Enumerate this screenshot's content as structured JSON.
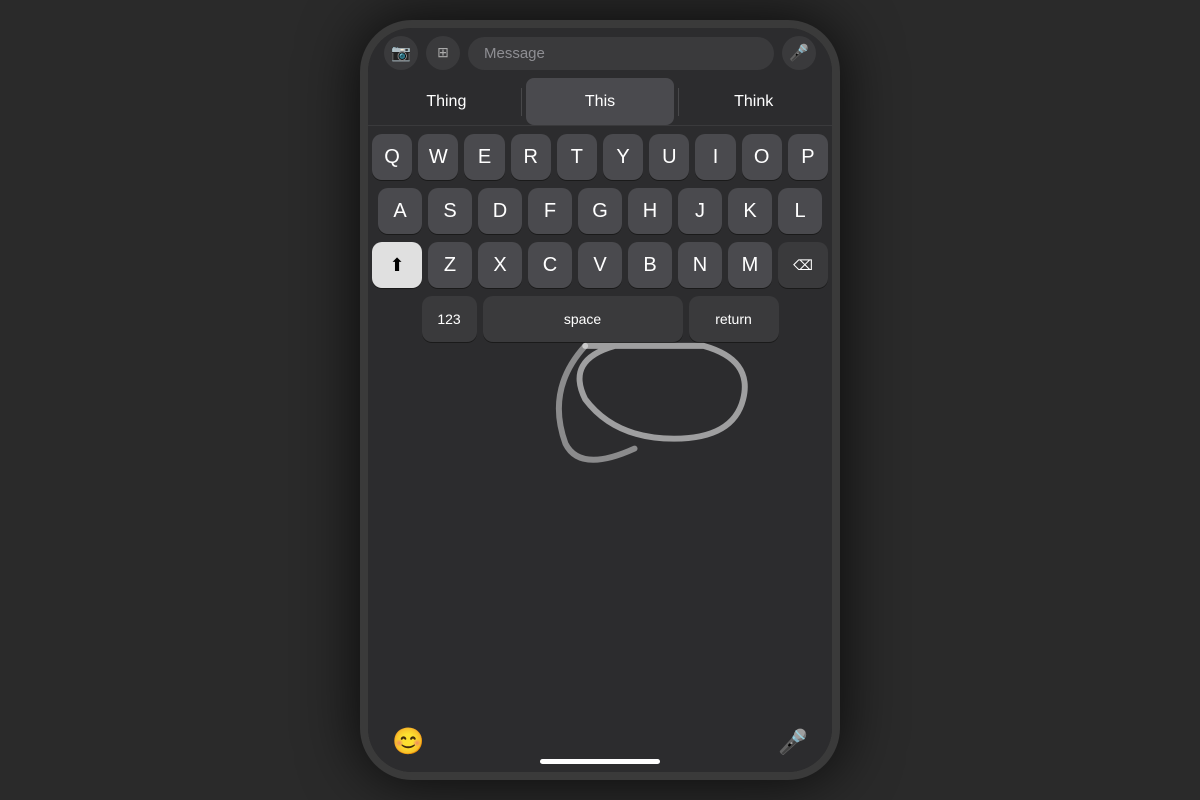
{
  "phone": {
    "top_bar": {
      "input_placeholder": "Message",
      "camera_icon": "📷",
      "apps_icon": "⊞",
      "mic_icon": "🎤"
    },
    "autocomplete": {
      "items": [
        {
          "label": "Thing",
          "selected": false
        },
        {
          "label": "This",
          "selected": true
        },
        {
          "label": "Think",
          "selected": false
        }
      ]
    },
    "keyboard": {
      "rows": [
        [
          "Q",
          "W",
          "E",
          "R",
          "T",
          "Y",
          "U",
          "I",
          "O",
          "P"
        ],
        [
          "A",
          "S",
          "D",
          "F",
          "G",
          "H",
          "J",
          "K",
          "L"
        ],
        [
          "Z",
          "X",
          "C",
          "V",
          "B",
          "N",
          "M"
        ]
      ],
      "shift_label": "⬆",
      "delete_label": "⌫",
      "numbers_label": "123",
      "space_label": "space",
      "return_label": "return"
    },
    "bottom_bar": {
      "emoji_icon": "😊",
      "mic_icon": "🎤"
    }
  }
}
